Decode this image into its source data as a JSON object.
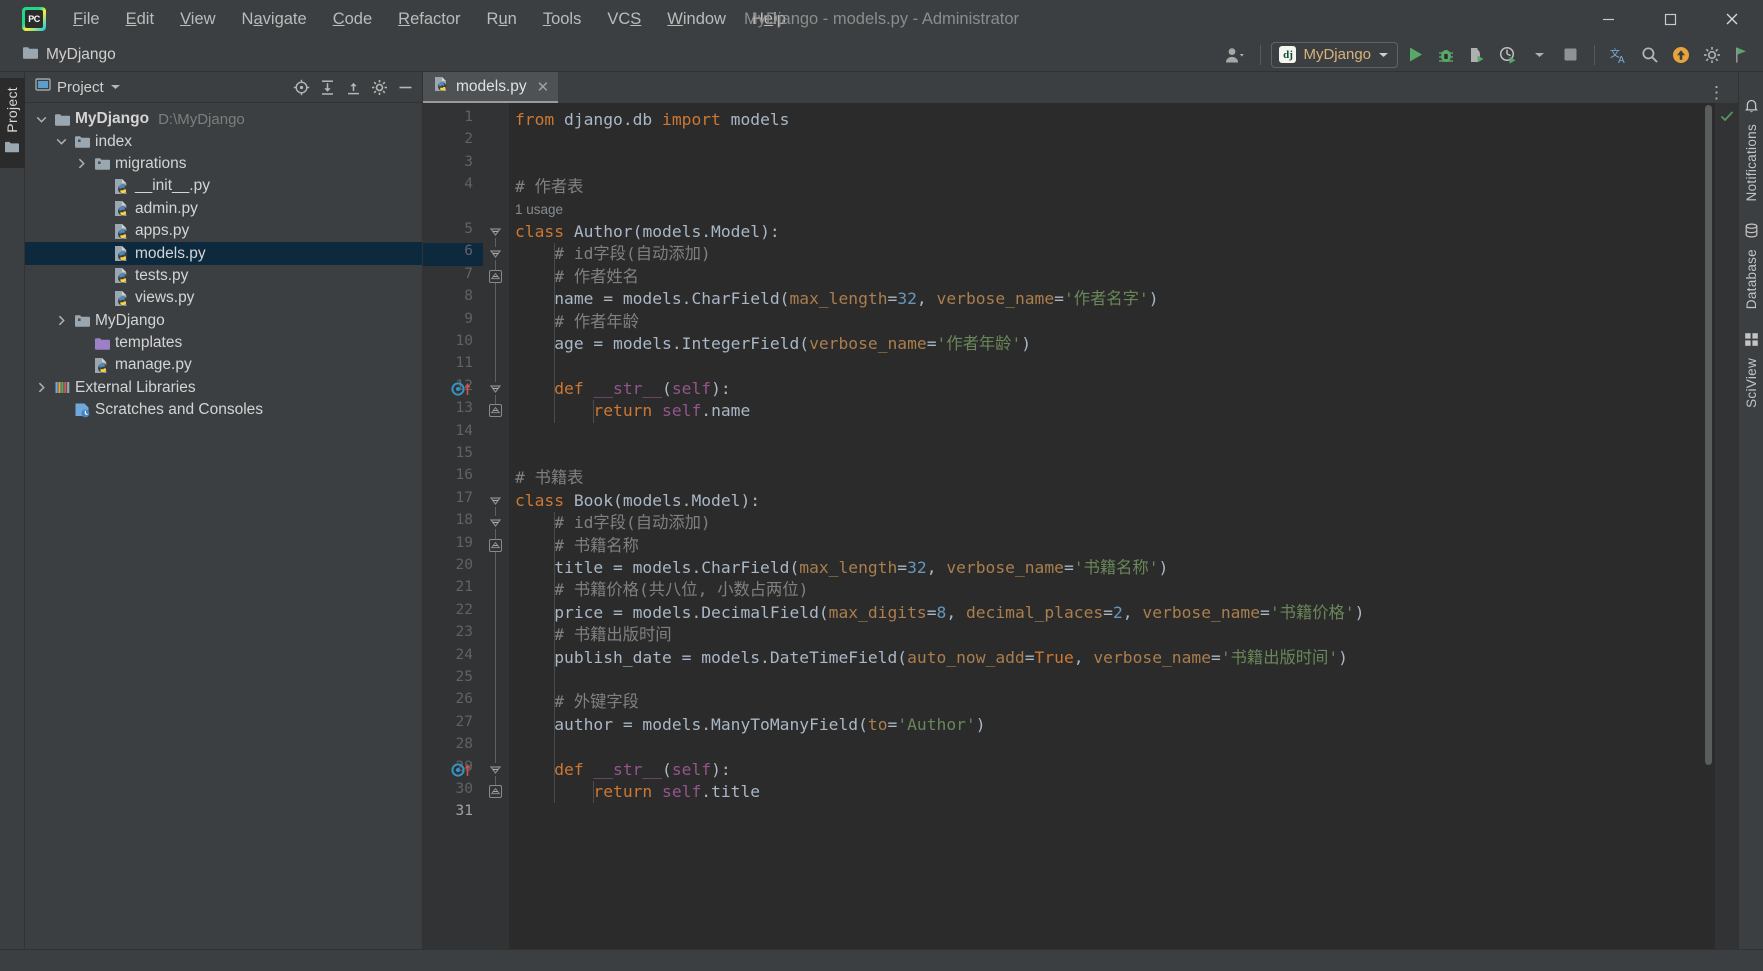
{
  "window": {
    "title": "MyDjango - models.py - Administrator",
    "logo_text": "PC",
    "minimize_label": "Minimize",
    "maximize_label": "Maximize",
    "close_label": "Close"
  },
  "menubar": {
    "items": [
      {
        "label": "File",
        "mnemonic": "F",
        "rest": "ile"
      },
      {
        "label": "Edit",
        "mnemonic": "E",
        "rest": "dit"
      },
      {
        "label": "View",
        "mnemonic": "V",
        "rest": "iew"
      },
      {
        "label": "Navigate",
        "pre": "N",
        "mnemonic": "a",
        "rest": "vigate"
      },
      {
        "label": "Code",
        "mnemonic": "C",
        "rest": "ode"
      },
      {
        "label": "Refactor",
        "mnemonic": "R",
        "rest": "efactor"
      },
      {
        "label": "Run",
        "pre": "R",
        "mnemonic": "u",
        "rest": "n"
      },
      {
        "label": "Tools",
        "mnemonic": "T",
        "rest": "ools"
      },
      {
        "label": "VCS",
        "pre": "VC",
        "mnemonic": "S",
        "rest": ""
      },
      {
        "label": "Window",
        "mnemonic": "W",
        "rest": "indow"
      },
      {
        "label": "Help",
        "pre": "H",
        "mnemonic": "e",
        "rest": "lp"
      }
    ]
  },
  "navbar": {
    "breadcrumb": "MyDjango",
    "breadcrumb_icon": "folder-icon",
    "avatar_icon": "account-icon",
    "run_config": {
      "name": "MyDjango",
      "framework_icon_text": "dj",
      "dropdown_icon": "chevron-down-icon"
    },
    "actions": [
      {
        "name": "run-button",
        "icon": "play-icon",
        "color": "#59a869"
      },
      {
        "name": "debug-button",
        "icon": "bug-icon",
        "color": "#59a869"
      },
      {
        "name": "run-coverage-button",
        "icon": "coverage-icon",
        "color": "#59a869"
      },
      {
        "name": "profile-button",
        "icon": "profiler-icon",
        "color": "#59a869"
      },
      {
        "name": "stop-button",
        "icon": "stop-icon",
        "color": "#9b9b9b"
      },
      {
        "name": "translate-button",
        "icon": "translate-icon",
        "color": "#6ba4d8"
      },
      {
        "name": "search-everywhere-button",
        "icon": "search-icon",
        "color": "#b0b0b0"
      },
      {
        "name": "updates-button",
        "icon": "arrow-up-circle-icon",
        "color": "#e8a33d"
      },
      {
        "name": "settings-button",
        "icon": "gear-icon",
        "color": "#9aa0a6"
      },
      {
        "name": "plugin-button",
        "icon": "flag-icon",
        "color": "#59a869"
      }
    ]
  },
  "left_rail": {
    "tab_label": "Project",
    "tab_icon": "folder-icon"
  },
  "right_rail": {
    "items": [
      {
        "label": "Notifications",
        "icon": "bell-icon"
      },
      {
        "label": "Database",
        "icon": "database-icon"
      },
      {
        "label": "SciView",
        "icon": "sciview-icon"
      }
    ]
  },
  "project_panel": {
    "title": "Project",
    "title_icon": "project-icon",
    "dropdown_icon": "chevron-down-icon",
    "toolbar": [
      {
        "name": "select-opened-file-button",
        "icon": "crosshair-icon"
      },
      {
        "name": "expand-all-button",
        "icon": "expand-all-icon"
      },
      {
        "name": "collapse-all-button",
        "icon": "collapse-all-icon"
      },
      {
        "name": "settings-button",
        "icon": "gear-icon"
      },
      {
        "name": "hide-button",
        "icon": "minus-icon"
      }
    ],
    "tree": [
      {
        "label": "MyDjango",
        "path": "D:\\MyDjango",
        "indent": 0,
        "arrow": "down",
        "icon": "folder-root-icon",
        "bold": true,
        "selected": false
      },
      {
        "label": "index",
        "path": "",
        "indent": 1,
        "arrow": "down",
        "icon": "folder-module-icon",
        "bold": false,
        "selected": false
      },
      {
        "label": "migrations",
        "path": "",
        "indent": 2,
        "arrow": "right",
        "icon": "folder-module-icon",
        "bold": false,
        "selected": false
      },
      {
        "label": "__init__.py",
        "path": "",
        "indent": 3,
        "arrow": "none",
        "icon": "python-file-icon",
        "bold": false,
        "selected": false
      },
      {
        "label": "admin.py",
        "path": "",
        "indent": 3,
        "arrow": "none",
        "icon": "python-file-icon",
        "bold": false,
        "selected": false
      },
      {
        "label": "apps.py",
        "path": "",
        "indent": 3,
        "arrow": "none",
        "icon": "python-file-icon",
        "bold": false,
        "selected": false
      },
      {
        "label": "models.py",
        "path": "",
        "indent": 3,
        "arrow": "none",
        "icon": "python-file-icon",
        "bold": false,
        "selected": true
      },
      {
        "label": "tests.py",
        "path": "",
        "indent": 3,
        "arrow": "none",
        "icon": "python-file-icon",
        "bold": false,
        "selected": false
      },
      {
        "label": "views.py",
        "path": "",
        "indent": 3,
        "arrow": "none",
        "icon": "python-file-icon",
        "bold": false,
        "selected": false
      },
      {
        "label": "MyDjango",
        "path": "",
        "indent": 1,
        "arrow": "right",
        "icon": "folder-module-icon",
        "bold": false,
        "selected": false
      },
      {
        "label": "templates",
        "path": "",
        "indent": 2,
        "arrow": "none",
        "icon": "folder-templates-icon",
        "bold": false,
        "selected": false
      },
      {
        "label": "manage.py",
        "path": "",
        "indent": 2,
        "arrow": "none",
        "icon": "python-file-icon",
        "bold": false,
        "selected": false
      },
      {
        "label": "External Libraries",
        "path": "",
        "indent": 0,
        "arrow": "right",
        "icon": "libraries-icon",
        "bold": false,
        "selected": false
      },
      {
        "label": "Scratches and Consoles",
        "path": "",
        "indent": 1,
        "arrow": "none",
        "icon": "scratches-icon",
        "bold": false,
        "selected": false
      }
    ]
  },
  "editor": {
    "tab": {
      "label": "models.py",
      "icon": "python-file-icon",
      "close_icon": "close-icon"
    },
    "options_icon": "more-vertical-icon",
    "inspection_status": "ok",
    "inspection_icon": "check-icon",
    "current_line": 31,
    "total_lines": 31,
    "inlay_hints": [
      {
        "after_line": 4,
        "text": "1 usage"
      }
    ],
    "gutter_markers": [
      {
        "line": 12,
        "icon": "override-method-icon"
      },
      {
        "line": 29,
        "icon": "override-method-icon"
      }
    ],
    "lines": [
      {
        "n": 1,
        "tokens": [
          {
            "t": "from ",
            "c": "k"
          },
          {
            "t": "django.db ",
            "c": "id"
          },
          {
            "t": "import ",
            "c": "k"
          },
          {
            "t": "models",
            "c": "id"
          }
        ]
      },
      {
        "n": 2,
        "tokens": []
      },
      {
        "n": 3,
        "tokens": []
      },
      {
        "n": 4,
        "tokens": [
          {
            "t": "# 作者表",
            "c": "c"
          }
        ]
      },
      {
        "n": 5,
        "tokens": [
          {
            "t": "class ",
            "c": "k"
          },
          {
            "t": "Author(models.Model):",
            "c": "id"
          }
        ]
      },
      {
        "n": 6,
        "tokens": [
          {
            "t": "    # id字段(自动添加)",
            "c": "c"
          }
        ]
      },
      {
        "n": 7,
        "tokens": [
          {
            "t": "    # 作者姓名",
            "c": "c"
          }
        ]
      },
      {
        "n": 8,
        "tokens": [
          {
            "t": "    name = models.CharField(",
            "c": "id"
          },
          {
            "t": "max_length",
            "c": "kw"
          },
          {
            "t": "=",
            "c": "id"
          },
          {
            "t": "32",
            "c": "n"
          },
          {
            "t": ", ",
            "c": "id"
          },
          {
            "t": "verbose_name",
            "c": "kw"
          },
          {
            "t": "=",
            "c": "id"
          },
          {
            "t": "'作者名字'",
            "c": "s"
          },
          {
            "t": ")",
            "c": "id"
          }
        ]
      },
      {
        "n": 9,
        "tokens": [
          {
            "t": "    # 作者年龄",
            "c": "c"
          }
        ]
      },
      {
        "n": 10,
        "tokens": [
          {
            "t": "    age = models.IntegerField(",
            "c": "id"
          },
          {
            "t": "verbose_name",
            "c": "kw"
          },
          {
            "t": "=",
            "c": "id"
          },
          {
            "t": "'作者年龄'",
            "c": "s"
          },
          {
            "t": ")",
            "c": "id"
          }
        ]
      },
      {
        "n": 11,
        "tokens": []
      },
      {
        "n": 12,
        "tokens": [
          {
            "t": "    def ",
            "c": "k"
          },
          {
            "t": "__str__",
            "c": "sf"
          },
          {
            "t": "(",
            "c": "id"
          },
          {
            "t": "self",
            "c": "sf"
          },
          {
            "t": "):",
            "c": "id"
          }
        ]
      },
      {
        "n": 13,
        "tokens": [
          {
            "t": "        return ",
            "c": "k"
          },
          {
            "t": "self",
            "c": "sf"
          },
          {
            "t": ".name",
            "c": "id"
          }
        ]
      },
      {
        "n": 14,
        "tokens": []
      },
      {
        "n": 15,
        "tokens": []
      },
      {
        "n": 16,
        "tokens": [
          {
            "t": "# 书籍表",
            "c": "c"
          }
        ]
      },
      {
        "n": 17,
        "tokens": [
          {
            "t": "class ",
            "c": "k"
          },
          {
            "t": "Book(models.Model):",
            "c": "id"
          }
        ]
      },
      {
        "n": 18,
        "tokens": [
          {
            "t": "    # id字段(自动添加)",
            "c": "c"
          }
        ]
      },
      {
        "n": 19,
        "tokens": [
          {
            "t": "    # 书籍名称",
            "c": "c"
          }
        ]
      },
      {
        "n": 20,
        "tokens": [
          {
            "t": "    title = models.CharField(",
            "c": "id"
          },
          {
            "t": "max_length",
            "c": "kw"
          },
          {
            "t": "=",
            "c": "id"
          },
          {
            "t": "32",
            "c": "n"
          },
          {
            "t": ", ",
            "c": "id"
          },
          {
            "t": "verbose_name",
            "c": "kw"
          },
          {
            "t": "=",
            "c": "id"
          },
          {
            "t": "'书籍名称'",
            "c": "s"
          },
          {
            "t": ")",
            "c": "id"
          }
        ]
      },
      {
        "n": 21,
        "tokens": [
          {
            "t": "    # 书籍价格(共八位, 小数占两位)",
            "c": "c"
          }
        ]
      },
      {
        "n": 22,
        "tokens": [
          {
            "t": "    price = models.DecimalField(",
            "c": "id"
          },
          {
            "t": "max_digits",
            "c": "kw"
          },
          {
            "t": "=",
            "c": "id"
          },
          {
            "t": "8",
            "c": "n"
          },
          {
            "t": ", ",
            "c": "id"
          },
          {
            "t": "decimal_places",
            "c": "kw"
          },
          {
            "t": "=",
            "c": "id"
          },
          {
            "t": "2",
            "c": "n"
          },
          {
            "t": ", ",
            "c": "id"
          },
          {
            "t": "verbose_name",
            "c": "kw"
          },
          {
            "t": "=",
            "c": "id"
          },
          {
            "t": "'书籍价格'",
            "c": "s"
          },
          {
            "t": ")",
            "c": "id"
          }
        ]
      },
      {
        "n": 23,
        "tokens": [
          {
            "t": "    # 书籍出版时间",
            "c": "c"
          }
        ]
      },
      {
        "n": 24,
        "tokens": [
          {
            "t": "    publish_date = models.DateTimeField(",
            "c": "id"
          },
          {
            "t": "auto_now_add",
            "c": "kw"
          },
          {
            "t": "=",
            "c": "id"
          },
          {
            "t": "True",
            "c": "k"
          },
          {
            "t": ", ",
            "c": "id"
          },
          {
            "t": "verbose_name",
            "c": "kw"
          },
          {
            "t": "=",
            "c": "id"
          },
          {
            "t": "'书籍出版时间'",
            "c": "s"
          },
          {
            "t": ")",
            "c": "id"
          }
        ]
      },
      {
        "n": 25,
        "tokens": []
      },
      {
        "n": 26,
        "tokens": [
          {
            "t": "    # 外键字段",
            "c": "c"
          }
        ]
      },
      {
        "n": 27,
        "tokens": [
          {
            "t": "    author = models.ManyToManyField(",
            "c": "id"
          },
          {
            "t": "to",
            "c": "kw"
          },
          {
            "t": "=",
            "c": "id"
          },
          {
            "t": "'Author'",
            "c": "s"
          },
          {
            "t": ")",
            "c": "id"
          }
        ]
      },
      {
        "n": 28,
        "tokens": []
      },
      {
        "n": 29,
        "tokens": [
          {
            "t": "    def ",
            "c": "k"
          },
          {
            "t": "__str__",
            "c": "sf"
          },
          {
            "t": "(",
            "c": "id"
          },
          {
            "t": "self",
            "c": "sf"
          },
          {
            "t": "):",
            "c": "id"
          }
        ]
      },
      {
        "n": 30,
        "tokens": [
          {
            "t": "        return ",
            "c": "k"
          },
          {
            "t": "self",
            "c": "sf"
          },
          {
            "t": ".title",
            "c": "id"
          }
        ]
      },
      {
        "n": 31,
        "tokens": []
      }
    ]
  },
  "colors": {
    "bg_chrome": "#3c3f41",
    "bg_editor": "#2b2b2b",
    "bg_gutter": "#313335",
    "selection_blue": "#0d293e",
    "keyword_orange": "#cc7832",
    "string_green": "#6a8759",
    "number_blue": "#6897bb",
    "kwarg_brown": "#aa7e4d",
    "comment_gray": "#808080",
    "text_default": "#a9b7c6",
    "accent_green": "#59a869",
    "magic_purple": "#94558d"
  }
}
